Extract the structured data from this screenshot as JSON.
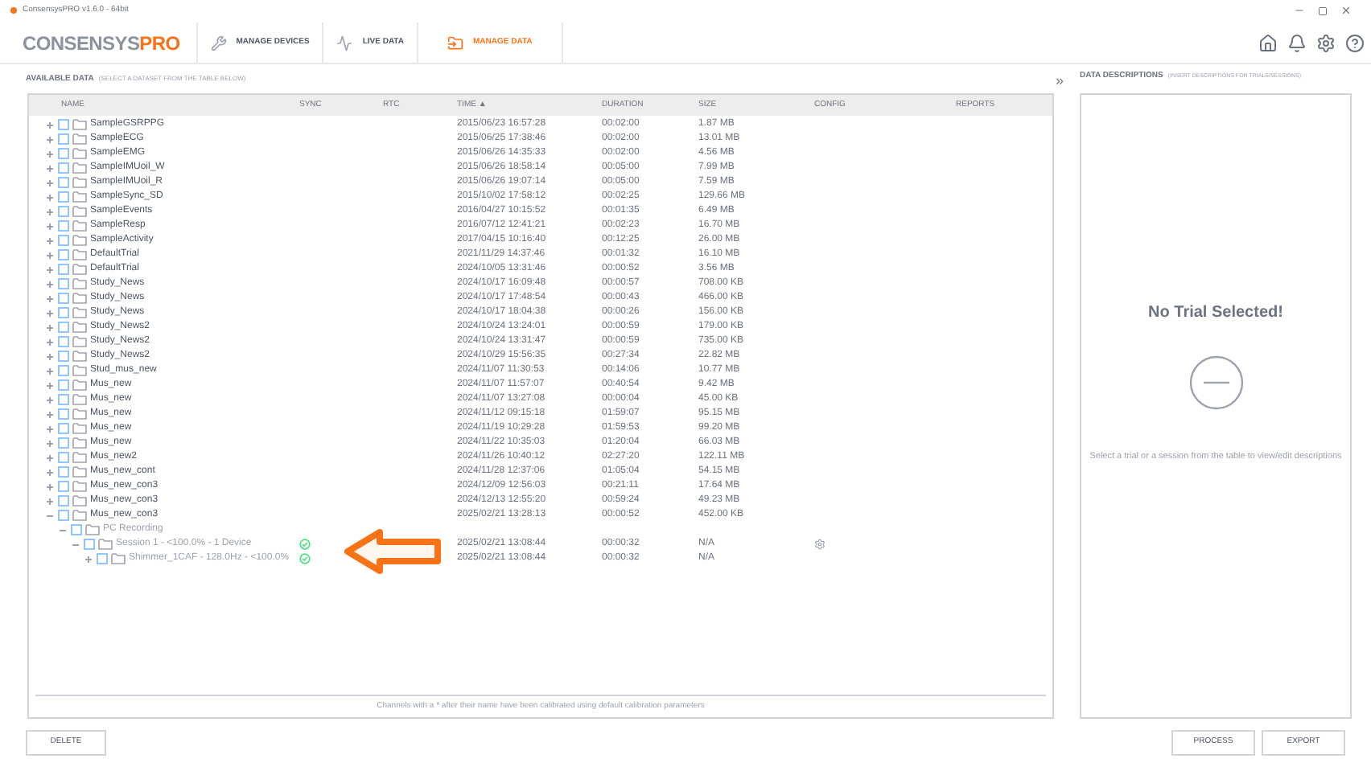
{
  "window": {
    "title": "ConsensysPRO v1.6.0 - 64bit"
  },
  "logo": {
    "main": "CONSENSYS",
    "suffix": "PRO"
  },
  "nav": [
    {
      "label": "MANAGE DEVICES",
      "kind": "devices",
      "selected": false
    },
    {
      "label": "LIVE DATA",
      "kind": "live",
      "selected": false
    },
    {
      "label": "MANAGE DATA",
      "kind": "data",
      "selected": true
    }
  ],
  "available": {
    "title": "AVAILABLE DATA",
    "hint": "(SELECT A DATASET FROM THE TABLE BELOW)"
  },
  "table": {
    "columns": [
      "NAME",
      "SYNC",
      "RTC",
      "TIME ▲",
      "DURATION",
      "SIZE",
      "CONFIG",
      "REPORTS"
    ],
    "rows": [
      {
        "name": "SampleGSRPPG",
        "time": "2015/06/23 16:57:28",
        "duration": "00:02:00",
        "size": "1.87 MB",
        "expanded": false,
        "checked": false
      },
      {
        "name": "SampleECG",
        "time": "2015/06/25 17:38:46",
        "duration": "00:02:00",
        "size": "13.01 MB",
        "expanded": false,
        "checked": false
      },
      {
        "name": "SampleEMG",
        "time": "2015/06/26 14:35:33",
        "duration": "00:02:00",
        "size": "4.56 MB",
        "expanded": false,
        "checked": false
      },
      {
        "name": "SampleIMUoil_W",
        "time": "2015/06/26 18:58:14",
        "duration": "00:05:00",
        "size": "7.99 MB",
        "expanded": false,
        "checked": false
      },
      {
        "name": "SampleIMUoil_R",
        "time": "2015/06/26 19:07:14",
        "duration": "00:05:00",
        "size": "7.59 MB",
        "expanded": false,
        "checked": false
      },
      {
        "name": "SampleSync_SD",
        "time": "2015/10/02 17:58:12",
        "duration": "00:02:25",
        "size": "129.66 MB",
        "expanded": false,
        "checked": false
      },
      {
        "name": "SampleEvents",
        "time": "2016/04/27 10:15:52",
        "duration": "00:01:35",
        "size": "6.49 MB",
        "expanded": false,
        "checked": false
      },
      {
        "name": "SampleResp",
        "time": "2016/07/12 12:41:21",
        "duration": "00:02:23",
        "size": "16.70 MB",
        "expanded": false,
        "checked": false
      },
      {
        "name": "SampleActivity",
        "time": "2017/04/15 10:16:40",
        "duration": "00:12:25",
        "size": "26.00 MB",
        "expanded": false,
        "checked": false
      },
      {
        "name": "DefaultTrial",
        "time": "2021/11/29 14:37:46",
        "duration": "00:01:32",
        "size": "16.10 MB",
        "expanded": false,
        "checked": false
      },
      {
        "name": "DefaultTrial",
        "time": "2024/10/05 13:31:46",
        "duration": "00:00:52",
        "size": "3.56 MB",
        "expanded": false,
        "checked": false
      },
      {
        "name": "Study_News",
        "time": "2024/10/17 16:09:48",
        "duration": "00:00:57",
        "size": "708.00 KB",
        "expanded": false,
        "checked": false
      },
      {
        "name": "Study_News",
        "time": "2024/10/17 17:48:54",
        "duration": "00:00:43",
        "size": "466.00 KB",
        "expanded": false,
        "checked": false
      },
      {
        "name": "Study_News",
        "time": "2024/10/17 18:04:38",
        "duration": "00:00:26",
        "size": "156.00 KB",
        "expanded": false,
        "checked": false
      },
      {
        "name": "Study_News2",
        "time": "2024/10/24 13:24:01",
        "duration": "00:00:59",
        "size": "179.00 KB",
        "expanded": false,
        "checked": false
      },
      {
        "name": "Study_News2",
        "time": "2024/10/24 13:31:47",
        "duration": "00:00:59",
        "size": "735.00 KB",
        "expanded": false,
        "checked": false
      },
      {
        "name": "Study_News2",
        "time": "2024/10/29 15:56:35",
        "duration": "00:27:34",
        "size": "22.82 MB",
        "expanded": false,
        "checked": false
      },
      {
        "name": "Stud_mus_new",
        "time": "2024/11/07 11:30:53",
        "duration": "00:14:06",
        "size": "10.77 MB",
        "expanded": false,
        "checked": false
      },
      {
        "name": "Mus_new",
        "time": "2024/11/07 11:57:07",
        "duration": "00:40:54",
        "size": "9.42 MB",
        "expanded": false,
        "checked": false
      },
      {
        "name": "Mus_new",
        "time": "2024/11/07 13:27:08",
        "duration": "00:00:04",
        "size": "45.00 KB",
        "expanded": false,
        "checked": false
      },
      {
        "name": "Mus_new",
        "time": "2024/11/12 09:15:18",
        "duration": "01:59:07",
        "size": "95.15 MB",
        "expanded": false,
        "checked": false
      },
      {
        "name": "Mus_new",
        "time": "2024/11/19 10:29:28",
        "duration": "01:59:53",
        "size": "99.20 MB",
        "expanded": false,
        "checked": false
      },
      {
        "name": "Mus_new",
        "time": "2024/11/22 10:35:03",
        "duration": "01:20:04",
        "size": "66.03 MB",
        "expanded": false,
        "checked": false
      },
      {
        "name": "Mus_new2",
        "time": "2024/11/26 10:40:12",
        "duration": "02:27:20",
        "size": "122.11 MB",
        "expanded": false,
        "checked": false
      },
      {
        "name": "Mus_new_cont",
        "time": "2024/11/28 12:37:06",
        "duration": "01:05:04",
        "size": "54.15 MB",
        "expanded": false,
        "checked": false
      },
      {
        "name": "Mus_new_con3",
        "time": "2024/12/09 12:56:03",
        "duration": "00:21:11",
        "size": "17.64 MB",
        "expanded": false,
        "checked": false
      },
      {
        "name": "Mus_new_con3",
        "time": "2024/12/13 12:55:20",
        "duration": "00:59:24",
        "size": "49.23 MB",
        "expanded": false,
        "checked": false
      },
      {
        "name": "Mus_new_con3",
        "time": "2025/02/21 13:28:13",
        "duration": "00:00:52",
        "size": "452.00 KB",
        "expanded": true,
        "checked": false,
        "children": [
          {
            "name": "PC Recording",
            "expanded": true,
            "checked": false,
            "children": [
              {
                "name": "Session 1 - <100.0% - 1 Device",
                "synced": true,
                "config": true,
                "time": "2025/02/21 13:08:44",
                "duration": "00:00:32",
                "size": "N/A",
                "expanded": true,
                "checked": false,
                "children": [
                  {
                    "name": "Shimmer_1CAF - 128.0Hz - <100.0%",
                    "synced": true,
                    "time": "2025/02/21 13:08:44",
                    "duration": "00:00:32",
                    "size": "N/A",
                    "expanded": false,
                    "checked": false
                  }
                ]
              }
            ]
          }
        ]
      }
    ],
    "footnote": "Channels with a * after their name have been calibrated using default calibration parameters"
  },
  "descriptions": {
    "title": "DATA DESCRIPTIONS",
    "hint": "(INSERT DESCRIPTIONS FOR TRIALS/SESSIONS)",
    "empty_title": "No Trial Selected!",
    "empty_text": "Select a trial or a session from the table to view/edit descriptions"
  },
  "collapse": "»",
  "buttons": {
    "left": [
      "DELETE"
    ],
    "right": [
      "PROCESS",
      "EXPORT"
    ]
  }
}
